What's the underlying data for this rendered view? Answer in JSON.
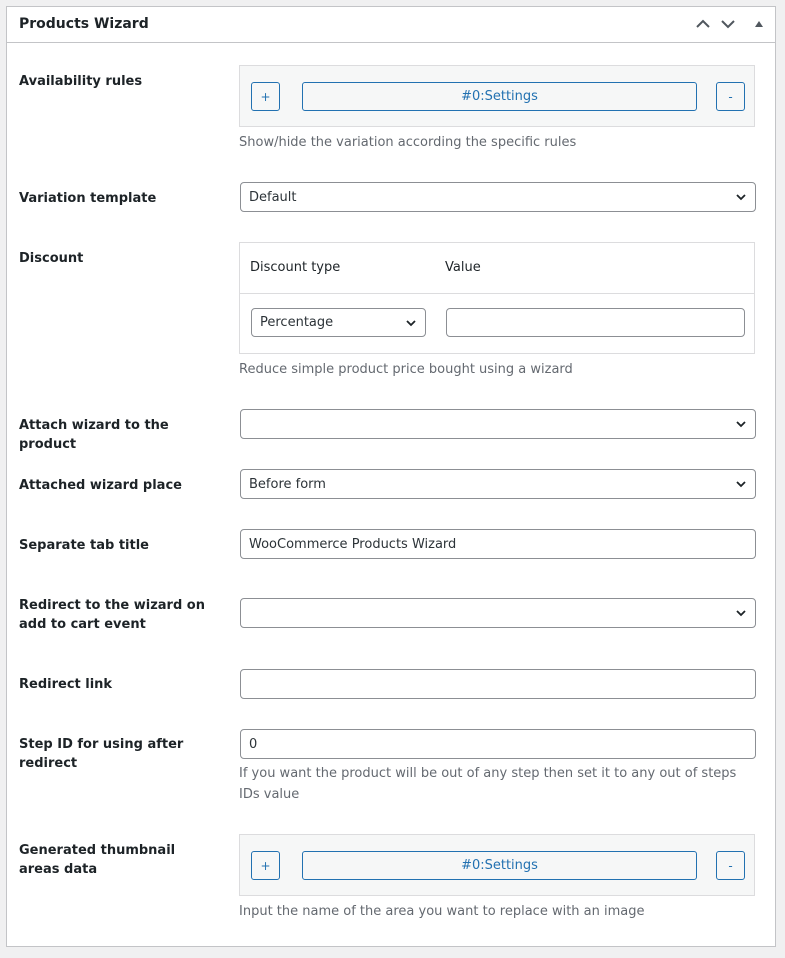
{
  "header": {
    "title": "Products Wizard",
    "icons": [
      "chevron-up-icon",
      "chevron-down-icon",
      "triangle-up-icon"
    ]
  },
  "availability": {
    "label": "Availability rules",
    "add_label": "+",
    "settings_label": "#0:Settings",
    "remove_label": "-",
    "description": "Show/hide the variation according the specific rules"
  },
  "variation_template": {
    "label": "Variation template",
    "value": "Default"
  },
  "discount": {
    "label": "Discount",
    "col_type": "Discount type",
    "col_value": "Value",
    "type_value": "Percentage",
    "value": "",
    "description": "Reduce simple product price bought using a wizard"
  },
  "attach_wizard": {
    "label": "Attach wizard to the product",
    "value": ""
  },
  "attached_place": {
    "label": "Attached wizard place",
    "value": "Before form"
  },
  "separate_tab": {
    "label": "Separate tab title",
    "value": "WooCommerce Products Wizard"
  },
  "redirect_event": {
    "label": "Redirect to the wizard on add to cart event",
    "value": ""
  },
  "redirect_link": {
    "label": "Redirect link",
    "value": ""
  },
  "step_id": {
    "label": "Step ID for using after redirect",
    "value": "0",
    "description": "If you want the product will be out of any step then set it to any out of steps IDs value"
  },
  "thumbnail_areas": {
    "label": "Generated thumbnail areas data",
    "add_label": "+",
    "settings_label": "#0:Settings",
    "remove_label": "-",
    "description": "Input the name of the area you want to replace with an image"
  },
  "colors": {
    "accent": "#2271b1",
    "border": "#8c8f94",
    "muted_text": "#646970"
  }
}
